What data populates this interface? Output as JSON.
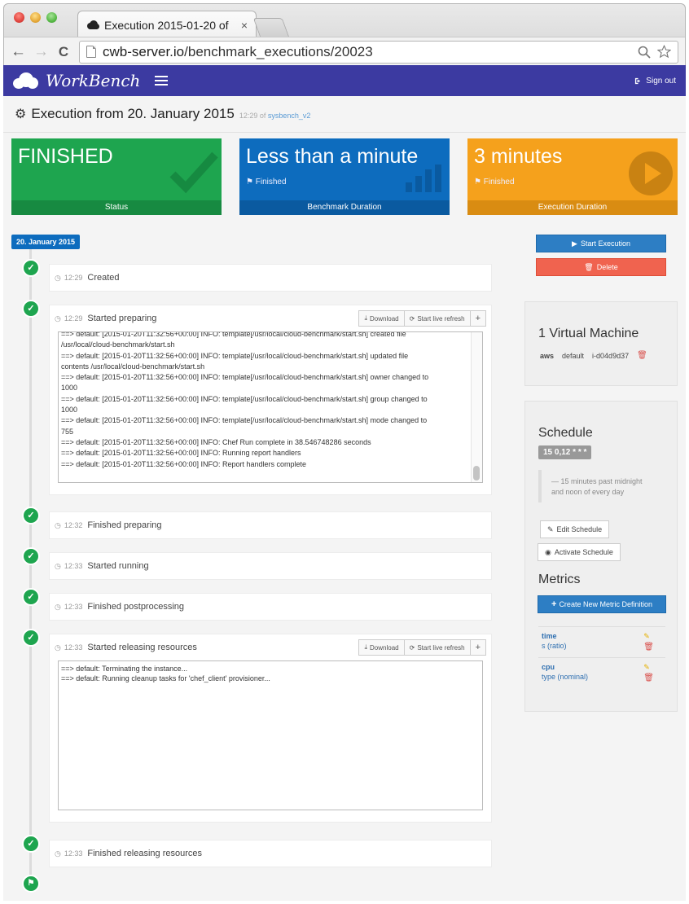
{
  "browser": {
    "tab_title": "Execution 2015-01-20 of",
    "tab_close": "×",
    "url_host": "cwb-server.io",
    "url_path": "/benchmark_executions/20023",
    "back_icon": "←",
    "forward_icon": "→",
    "reload_icon": "C"
  },
  "navbar": {
    "brand": "WorkBench",
    "signout": "Sign out",
    "color": "#3c3aa1"
  },
  "heading": {
    "title": "Execution from 20. January 2015",
    "time": "12:29",
    "of_text": "of",
    "benchmark_link": "sysbench_v2"
  },
  "tiles": {
    "status": {
      "value": "FINISHED",
      "footer": "Status",
      "color": "#1ea54f"
    },
    "benchmark": {
      "value": "Less than a minute",
      "sub": "Finished",
      "footer": "Benchmark Duration",
      "color": "#0d6cbe"
    },
    "execution": {
      "value": "3 minutes",
      "sub": "Finished",
      "footer": "Execution Duration",
      "color": "#f5a11c"
    }
  },
  "timeline": {
    "date": "20. January 2015",
    "events": [
      {
        "time": "12:29",
        "label": "Created"
      },
      {
        "time": "12:29",
        "label": "Started preparing"
      },
      {
        "time": "12:32",
        "label": "Finished preparing"
      },
      {
        "time": "12:33",
        "label": "Started running"
      },
      {
        "time": "12:33",
        "label": "Finished postprocessing"
      },
      {
        "time": "12:33",
        "label": "Started releasing resources"
      },
      {
        "time": "12:33",
        "label": "Finished releasing resources"
      }
    ],
    "download_label": "Download",
    "refresh_label": "Start live refresh",
    "expand_label": "+",
    "log_preparing": [
      "==> default: [2015-01-20T11:32:56+00:00] INFO: template[/usr/local/cloud-benchmark/start.sh] created file",
      "/usr/local/cloud-benchmark/start.sh",
      "==> default: [2015-01-20T11:32:56+00:00] INFO: template[/usr/local/cloud-benchmark/start.sh] updated file",
      "contents /usr/local/cloud-benchmark/start.sh",
      "==> default: [2015-01-20T11:32:56+00:00] INFO: template[/usr/local/cloud-benchmark/start.sh] owner changed to",
      "1000",
      "==> default: [2015-01-20T11:32:56+00:00] INFO: template[/usr/local/cloud-benchmark/start.sh] group changed to",
      "1000",
      "==> default: [2015-01-20T11:32:56+00:00] INFO: template[/usr/local/cloud-benchmark/start.sh] mode changed to",
      "755",
      "==> default: [2015-01-20T11:32:56+00:00] INFO: Chef Run complete in 38.546748286 seconds",
      "==> default: [2015-01-20T11:32:56+00:00] INFO: Running report handlers",
      "==> default: [2015-01-20T11:32:56+00:00] INFO: Report handlers complete"
    ],
    "log_releasing": [
      "==> default: Terminating the instance...",
      "==> default: Running cleanup tasks for 'chef_client' provisioner..."
    ]
  },
  "actions": {
    "start_execution": "Start Execution",
    "delete": "Delete"
  },
  "vm_panel": {
    "title": "1 Virtual Machine",
    "provider": "aws",
    "role": "default",
    "instance_id": "i-d04d9d37"
  },
  "schedule": {
    "title": "Schedule",
    "cron": "15 0,12 * * *",
    "description_line1": "— 15 minutes past midnight",
    "description_line2": "and noon of every day",
    "edit_label": "Edit Schedule",
    "activate_label": "Activate Schedule"
  },
  "metrics": {
    "title": "Metrics",
    "create_label": "Create New Metric Definition",
    "items": [
      {
        "name": "time",
        "unit": "s (ratio)"
      },
      {
        "name": "cpu",
        "unit": "type (nominal)"
      }
    ]
  }
}
